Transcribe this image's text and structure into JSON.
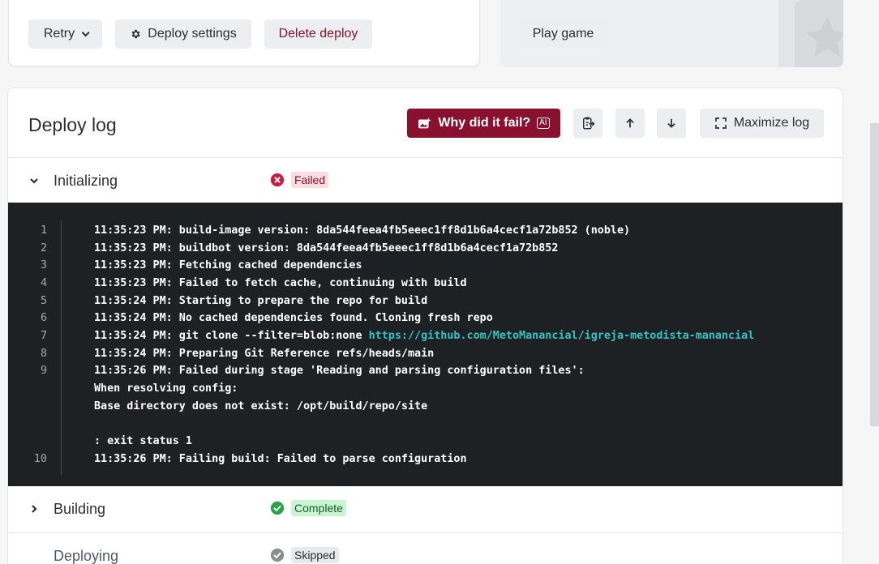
{
  "top_actions": {
    "retry_label": "Retry",
    "deploy_settings_label": "Deploy settings",
    "delete_deploy_label": "Delete deploy",
    "play_game_label": "Play game"
  },
  "deploy_log": {
    "title": "Deploy log",
    "why_fail_label": "Why did it fail?",
    "ai_badge": "AI",
    "maximize_label": "Maximize log",
    "colors": {
      "brand": "#8a1030",
      "terminal_bg": "#1e2124",
      "link": "#34c3c3"
    }
  },
  "stages": [
    {
      "label": "Initializing",
      "status": "Failed",
      "icon": "x-circle-icon"
    },
    {
      "label": "Building",
      "status": "Complete",
      "icon": "check-circle-icon"
    },
    {
      "label": "Deploying",
      "status": "Skipped",
      "icon": "skip-circle-icon"
    }
  ],
  "log_lines": [
    {
      "n": "1",
      "text": "11:35:23 PM: build-image version: 8da544feea4fb5eeec1ff8d1b6a4cecf1a72b852 (noble)"
    },
    {
      "n": "2",
      "text": "11:35:23 PM: buildbot version: 8da544feea4fb5eeec1ff8d1b6a4cecf1a72b852"
    },
    {
      "n": "3",
      "text": "11:35:23 PM: Fetching cached dependencies"
    },
    {
      "n": "4",
      "text": "11:35:23 PM: Failed to fetch cache, continuing with build"
    },
    {
      "n": "5",
      "text": "11:35:24 PM: Starting to prepare the repo for build"
    },
    {
      "n": "6",
      "text": "11:35:24 PM: No cached dependencies found. Cloning fresh repo"
    },
    {
      "n": "7",
      "text": "11:35:24 PM: git clone --filter=blob:none ",
      "link": "https://github.com/MetoManancial/igreja-metodista-manancial"
    },
    {
      "n": "8",
      "text": "11:35:24 PM: Preparing Git Reference refs/heads/main"
    },
    {
      "n": "9",
      "text": "11:35:26 PM: Failed during stage 'Reading and parsing configuration files':"
    },
    {
      "n": "",
      "text": "When resolving config:"
    },
    {
      "n": "",
      "text": "Base directory does not exist: /opt/build/repo/site"
    },
    {
      "n": "",
      "text": ""
    },
    {
      "n": "",
      "text": ": exit status 1"
    },
    {
      "n": "10",
      "text": "11:35:26 PM: Failing build: Failed to parse configuration"
    }
  ]
}
